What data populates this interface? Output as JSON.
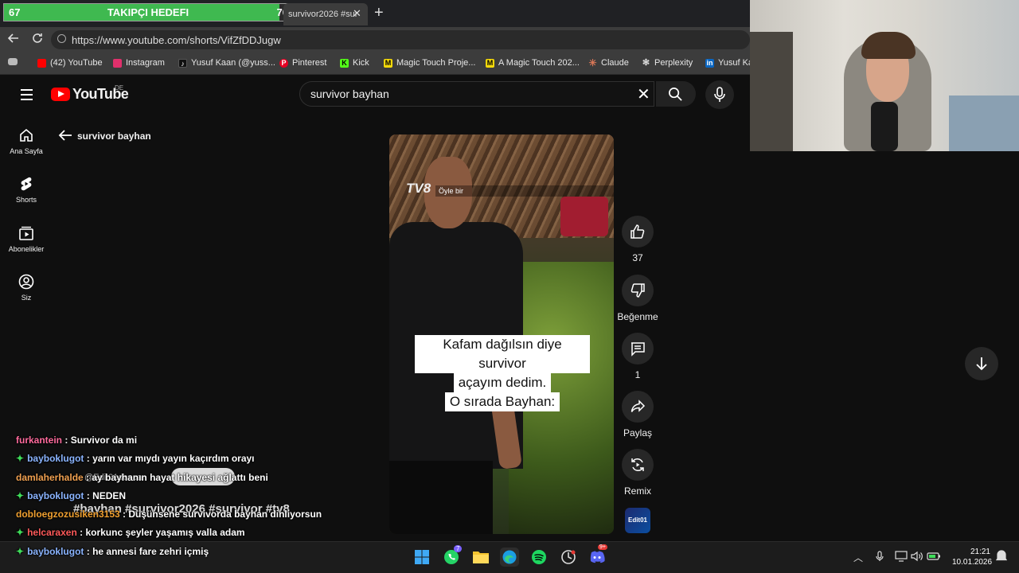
{
  "stream_overlay": {
    "goal_title": "TAKIPÇI HEDEFI",
    "goal_current": "67",
    "goal_target": "70",
    "goal_progress": 0.957
  },
  "browser": {
    "tab_title": "survivor2026 #sur",
    "url": "https://www.youtube.com/shorts/VifZfDDJugw",
    "bookmarks": [
      {
        "label": "(42) YouTube",
        "icon": "youtube-icon",
        "color": "#ff0000"
      },
      {
        "label": "Instagram",
        "icon": "instagram-icon",
        "color": "#e1306c"
      },
      {
        "label": "Yusuf Kaan (@yuss...",
        "icon": "tiktok-icon",
        "color": "#ffffff"
      },
      {
        "label": "Pinterest",
        "icon": "pinterest-icon",
        "color": "#e60023"
      },
      {
        "label": "Kick",
        "icon": "kick-icon",
        "color": "#53fc18"
      },
      {
        "label": "Magic Touch Proje...",
        "icon": "magic-touch-icon",
        "color": "#f5d90a"
      },
      {
        "label": "A Magic Touch 202...",
        "icon": "magic-touch-icon",
        "color": "#f5d90a"
      },
      {
        "label": "Claude",
        "icon": "claude-icon",
        "color": "#d97757"
      },
      {
        "label": "Perplexity",
        "icon": "perplexity-icon",
        "color": "#dddddd"
      },
      {
        "label": "Yusuf Ka",
        "icon": "linkedin-icon",
        "color": "#0a66c2"
      }
    ]
  },
  "youtube": {
    "logo_text": "YouTube",
    "country": "DE",
    "search_value": "survivor bayhan",
    "back_label": "survivor bayhan",
    "sidebar": [
      {
        "label": "Ana Sayfa",
        "icon": "home-icon"
      },
      {
        "label": "Shorts",
        "icon": "shorts-icon"
      },
      {
        "label": "Abonelikler",
        "icon": "subscriptions-icon"
      },
      {
        "label": "Siz",
        "icon": "you-icon"
      }
    ],
    "short": {
      "tv_text": "TV8",
      "tv_caption": "Öyle bir",
      "caption_lines": [
        "Kafam dağılsın diye survivor",
        "açayım dedim.",
        "O sırada Bayhan:"
      ],
      "channel_thumb_text": "Edit01"
    },
    "actions": {
      "like_count": "37",
      "dislike_label": "Beğenme",
      "comment_count": "1",
      "share_label": "Paylaş",
      "remix_label": "Remix"
    }
  },
  "chat": [
    {
      "user": "furkantein",
      "color": "#ff6b9d",
      "badge": false,
      "text": ": Survivor da mi"
    },
    {
      "user": "bayboklugot",
      "color": "#8ab4ff",
      "badge": true,
      "text": ": yarın var mıydı yayın kaçırdım orayı"
    },
    {
      "user": "damlaherhalde",
      "color": "#f0a050",
      "badge": false,
      "text": ": ay bayhanın hayat hikayesi ağlattı beni"
    },
    {
      "user": "bayboklugot",
      "color": "#8ab4ff",
      "badge": true,
      "text": ": NEDEN"
    },
    {
      "user": "dobloegzozusiken3153",
      "color": "#f0a030",
      "badge": false,
      "text": ": Düşünsene survivorda bayhan dinliyorsun"
    },
    {
      "user": "helcaraxen",
      "color": "#ff5a5a",
      "badge": true,
      "text": ": korkunc şeyler yaşamış valla adam"
    },
    {
      "user": "bayboklugot",
      "color": "#8ab4ff",
      "badge": true,
      "text": ": he annesi fare zehri içmiş"
    }
  ],
  "video_overlay": {
    "hashtags": "#bayhan #survivor2026 #survivor #tv8",
    "mention": "@Edit01dencar"
  },
  "taskbar": {
    "time": "21:21",
    "date": "10.01.2026",
    "whatsapp_badge": "7",
    "discord_badge": "9+"
  }
}
